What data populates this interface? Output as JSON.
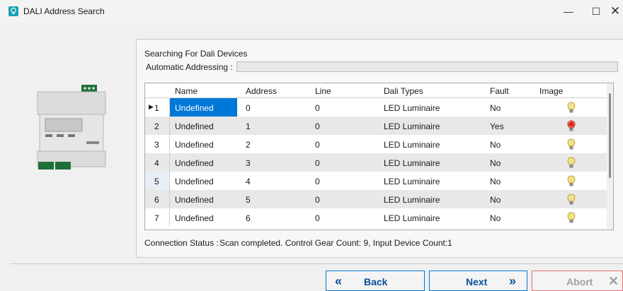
{
  "window": {
    "title": "DALI Address Search",
    "minimize_glyph": "—",
    "maximize_glyph": "☐",
    "close_glyph": "✕",
    "icon": "lightbulb-app-icon"
  },
  "panel": {
    "searching_label": "Searching For Dali Devices",
    "auto_addressing_label": "Automatic Addressing :",
    "auto_addressing_progress": 0
  },
  "grid": {
    "columns": [
      "Name",
      "Address",
      "Line",
      "Dali Types",
      "Fault",
      "Image"
    ],
    "rows": [
      {
        "num": "1",
        "name": "Undefined",
        "address": "0",
        "line": "0",
        "type": "LED Luminaire",
        "fault": "No",
        "image": "bulb-ok-icon"
      },
      {
        "num": "2",
        "name": "Undefined",
        "address": "1",
        "line": "0",
        "type": "LED Luminaire",
        "fault": "Yes",
        "image": "bulb-fault-icon"
      },
      {
        "num": "3",
        "name": "Undefined",
        "address": "2",
        "line": "0",
        "type": "LED Luminaire",
        "fault": "No",
        "image": "bulb-ok-icon"
      },
      {
        "num": "4",
        "name": "Undefined",
        "address": "3",
        "line": "0",
        "type": "LED Luminaire",
        "fault": "No",
        "image": "bulb-ok-icon"
      },
      {
        "num": "5",
        "name": "Undefined",
        "address": "4",
        "line": "0",
        "type": "LED Luminaire",
        "fault": "No",
        "image": "bulb-ok-icon"
      },
      {
        "num": "6",
        "name": "Undefined",
        "address": "5",
        "line": "0",
        "type": "LED Luminaire",
        "fault": "No",
        "image": "bulb-ok-icon"
      },
      {
        "num": "7",
        "name": "Undefined",
        "address": "6",
        "line": "0",
        "type": "LED Luminaire",
        "fault": "No",
        "image": "bulb-ok-icon"
      }
    ],
    "current_row_marker": "▶",
    "selected_row": 1
  },
  "status": {
    "label": "Connection Status :",
    "text": "Scan completed. Control Gear Count: 9, Input Device Count:1"
  },
  "buttons": {
    "back_label": "Back",
    "back_icon_glyph": "«",
    "next_label": "Next",
    "next_icon_glyph": "»",
    "abort_label": "Abort",
    "abort_icon_glyph": "✕"
  },
  "colors": {
    "accent": "#0078d7",
    "selection": "#0078d7",
    "abort_border": "#e07070",
    "progress_fill": "#06b025"
  }
}
